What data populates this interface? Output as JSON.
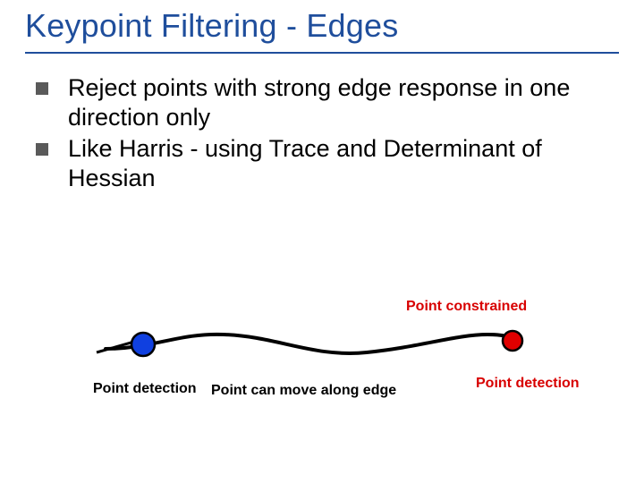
{
  "title": "Keypoint Filtering - Edges",
  "bullets": [
    "Reject points with strong edge response in one direction only",
    "Like Harris - using Trace and Determinant of Hessian"
  ],
  "figure": {
    "label_constrained": "Point constrained",
    "label_detection_left": "Point detection",
    "label_move": "Point can move along edge",
    "label_detection_right": "Point detection"
  }
}
